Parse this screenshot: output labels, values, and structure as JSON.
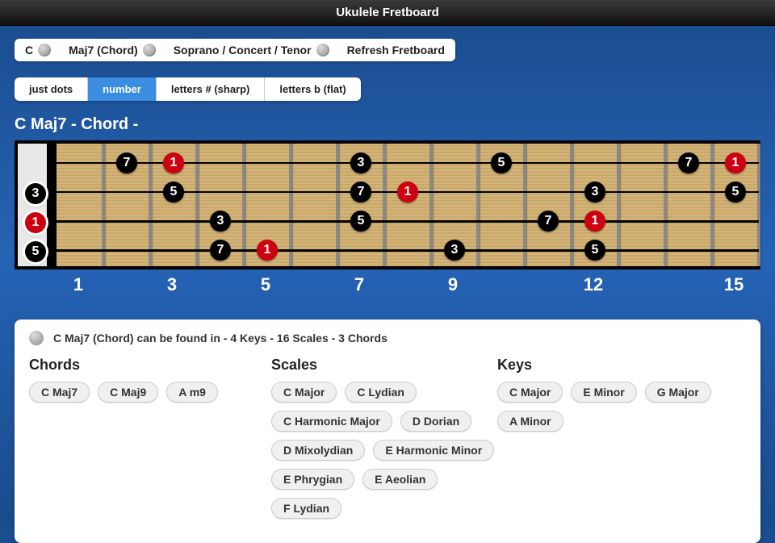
{
  "title": "Ukulele Fretboard",
  "selectors": {
    "key": "C",
    "chord": "Maj7 (Chord)",
    "instrument": "Soprano / Concert / Tenor",
    "refresh": "Refresh Fretboard"
  },
  "segments": [
    "just dots",
    "number",
    "letters # (sharp)",
    "letters b (flat)"
  ],
  "active_segment": 1,
  "chord_title": "C Maj7 - Chord -",
  "fretboard": {
    "strings": 4,
    "frets": 15,
    "markers": [
      1,
      3,
      5,
      7,
      9,
      12,
      15
    ],
    "open": [
      "3",
      "1",
      "5"
    ],
    "open_color": [
      "black",
      "red",
      "black"
    ],
    "open_string": [
      1,
      2,
      3
    ],
    "notes": [
      {
        "s": 0,
        "f": 2,
        "n": "7",
        "c": "black"
      },
      {
        "s": 0,
        "f": 3,
        "n": "1",
        "c": "red"
      },
      {
        "s": 0,
        "f": 7,
        "n": "3",
        "c": "black"
      },
      {
        "s": 0,
        "f": 10,
        "n": "5",
        "c": "black"
      },
      {
        "s": 0,
        "f": 14,
        "n": "7",
        "c": "black"
      },
      {
        "s": 0,
        "f": 15,
        "n": "1",
        "c": "red"
      },
      {
        "s": 1,
        "f": 3,
        "n": "5",
        "c": "black"
      },
      {
        "s": 1,
        "f": 7,
        "n": "7",
        "c": "black"
      },
      {
        "s": 1,
        "f": 8,
        "n": "1",
        "c": "red"
      },
      {
        "s": 1,
        "f": 12,
        "n": "3",
        "c": "black"
      },
      {
        "s": 1,
        "f": 15,
        "n": "5",
        "c": "black"
      },
      {
        "s": 2,
        "f": 4,
        "n": "3",
        "c": "black"
      },
      {
        "s": 2,
        "f": 7,
        "n": "5",
        "c": "black"
      },
      {
        "s": 2,
        "f": 11,
        "n": "7",
        "c": "black"
      },
      {
        "s": 2,
        "f": 12,
        "n": "1",
        "c": "red"
      },
      {
        "s": 3,
        "f": 4,
        "n": "7",
        "c": "black"
      },
      {
        "s": 3,
        "f": 5,
        "n": "1",
        "c": "red"
      },
      {
        "s": 3,
        "f": 9,
        "n": "3",
        "c": "black"
      },
      {
        "s": 3,
        "f": 12,
        "n": "5",
        "c": "black"
      }
    ]
  },
  "info": {
    "summary": "C Maj7 (Chord) can be found in - 4 Keys - 16 Scales - 3 Chords",
    "chords_label": "Chords",
    "scales_label": "Scales",
    "keys_label": "Keys",
    "chords": [
      "C Maj7",
      "C Maj9",
      "A m9"
    ],
    "scales_rows": [
      [
        "C Major",
        "C Lydian"
      ],
      [
        "C Harmonic Major",
        "D Dorian"
      ],
      [
        "D Mixolydian",
        "E Harmonic Minor"
      ],
      [
        "E Phrygian",
        "E Aeolian",
        "F Lydian"
      ]
    ],
    "keys_rows": [
      [
        "C Major",
        "E Minor",
        "G Major"
      ],
      [
        "A Minor"
      ]
    ]
  }
}
